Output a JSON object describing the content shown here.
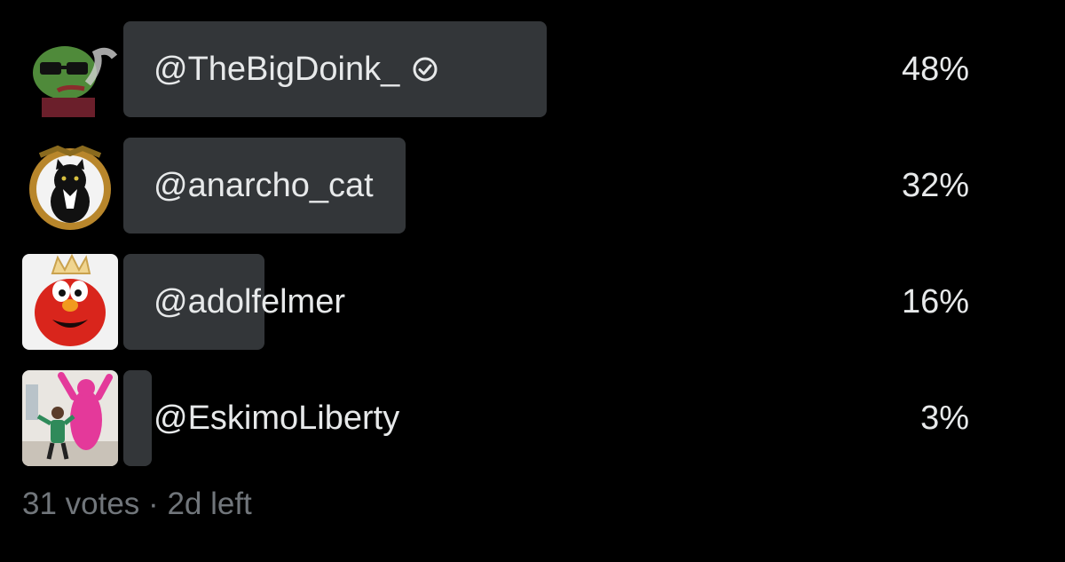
{
  "poll": {
    "options": [
      {
        "label": "@TheBigDoink_",
        "percent_text": "48%",
        "percent": 48,
        "verified": true,
        "avatar_icon": "frog-meme-avatar"
      },
      {
        "label": "@anarcho_cat",
        "percent_text": "32%",
        "percent": 32,
        "verified": false,
        "avatar_icon": "cat-emblem-avatar"
      },
      {
        "label": "@adolfelmer",
        "percent_text": "16%",
        "percent": 16,
        "verified": false,
        "avatar_icon": "red-puppet-avatar"
      },
      {
        "label": "@EskimoLiberty",
        "percent_text": "3%",
        "percent": 3,
        "verified": false,
        "avatar_icon": "pink-costume-photo-avatar"
      }
    ],
    "footer": {
      "votes": "31 votes",
      "separator": "·",
      "time_left": "2d left"
    }
  },
  "colors": {
    "background": "#000000",
    "bar": "#333639",
    "text": "#e7e9ea",
    "muted": "#71767b"
  }
}
